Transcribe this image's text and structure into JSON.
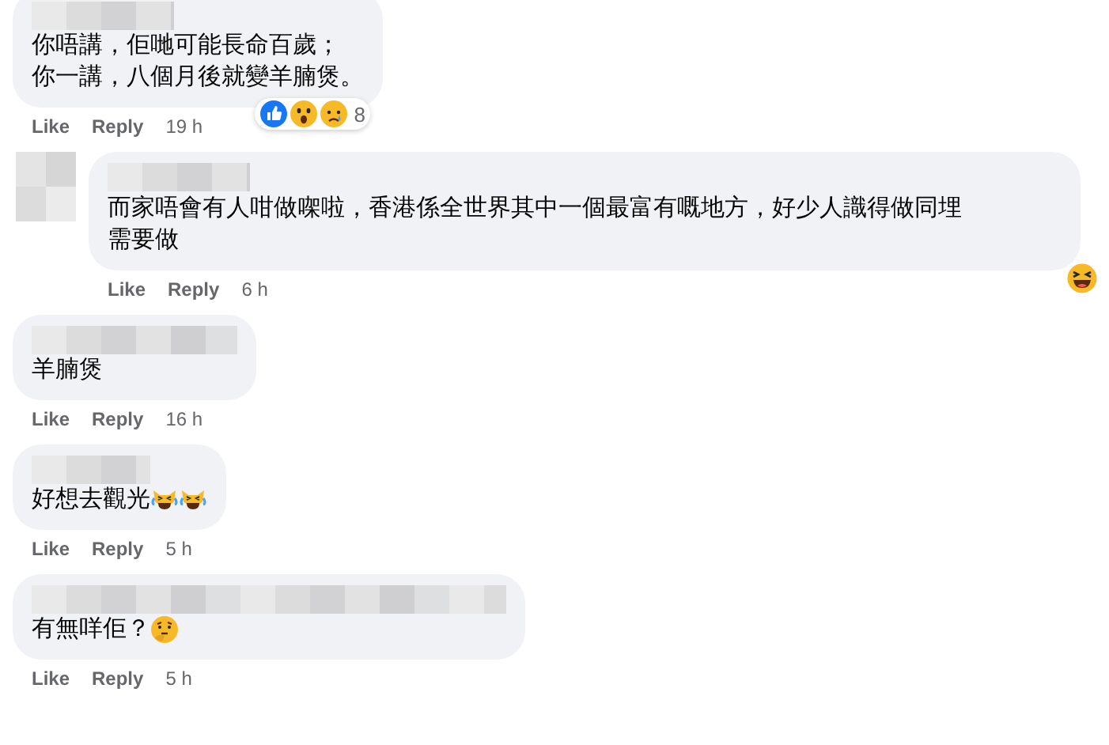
{
  "comments": [
    {
      "avatar": false,
      "lines": [
        "你唔講，佢哋可能長命百歲；",
        "你一講，八個月後就變羊腩煲。"
      ],
      "reactions": {
        "icons": [
          {
            "kind": "like"
          },
          {
            "kind": "wow"
          },
          {
            "kind": "sad"
          }
        ],
        "count": "8"
      },
      "actions": [
        "Like",
        "Reply"
      ],
      "time": "19 h"
    },
    {
      "avatar": true,
      "lines": [
        "而家唔會有人咁做㗎啦，香港係全世界其中一個最富有嘅地方，好少人識得做同埋需要做"
      ],
      "reactions": {
        "icons": [
          {
            "kind": "haha"
          }
        ]
      },
      "actions": [
        "Like",
        "Reply"
      ],
      "time": "6 h"
    },
    {
      "avatar": false,
      "lines": [
        "羊腩煲"
      ],
      "actions": [
        "Like",
        "Reply"
      ],
      "time": "16 h"
    },
    {
      "avatar": false,
      "lines": [
        "好想去觀光"
      ],
      "emoji": [
        {
          "kind": "laughing-cat"
        },
        {
          "kind": "laughing-cat"
        }
      ],
      "actions": [
        "Like",
        "Reply"
      ],
      "time": "5 h"
    },
    {
      "avatar": false,
      "lines": [
        "有無咩佢？"
      ],
      "emoji": [
        {
          "kind": "thinking"
        }
      ],
      "actions": [
        "Like",
        "Reply"
      ],
      "time": "5 h"
    }
  ]
}
